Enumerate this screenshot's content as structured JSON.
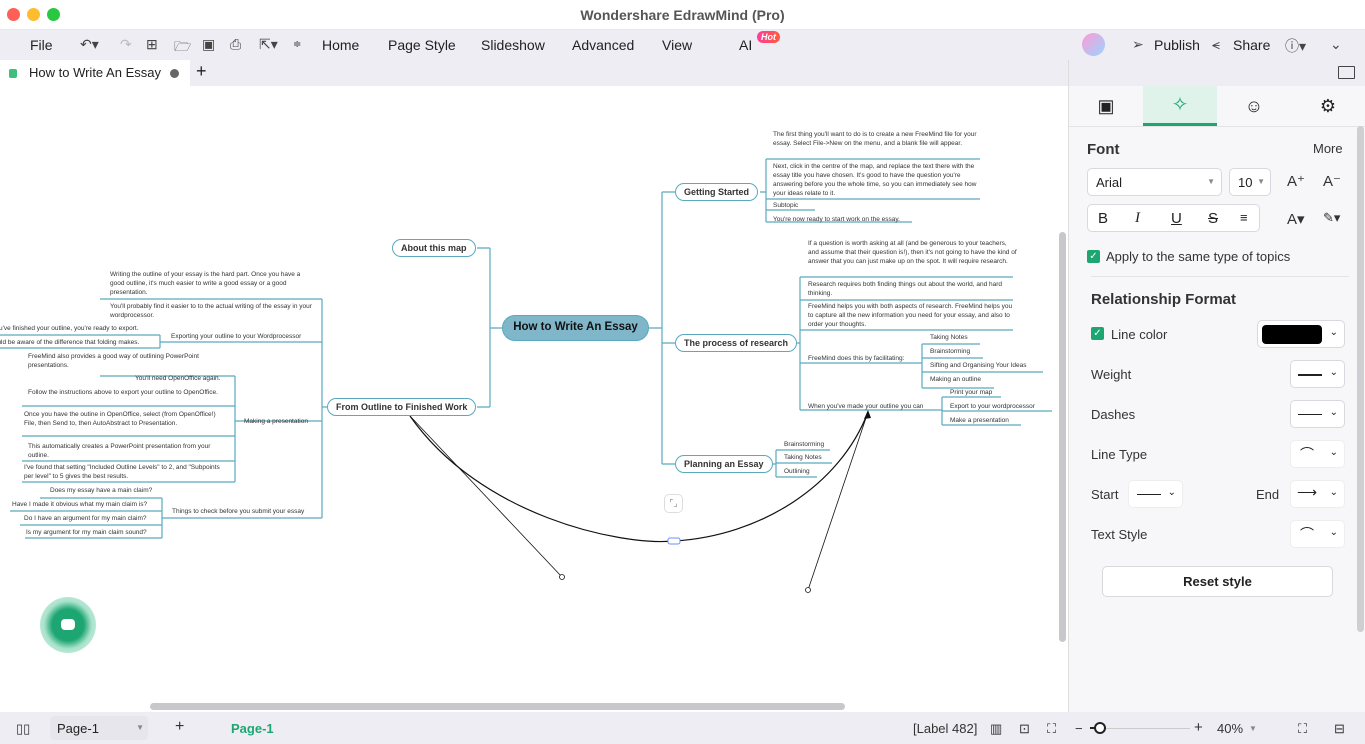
{
  "window": {
    "title": "Wondershare EdrawMind (Pro)"
  },
  "menu": {
    "file": "File",
    "items": [
      "Home",
      "Page Style",
      "Slideshow",
      "Advanced",
      "View",
      "AI"
    ],
    "ai_badge": "Hot",
    "publish": "Publish",
    "share": "Share"
  },
  "tabs": {
    "doc_title": "How to Write An Essay",
    "add_tab": "+"
  },
  "mindmap": {
    "root": "How to Write An Essay",
    "right_topics": {
      "getting_started": {
        "label": "Getting Started",
        "children": [
          "The first thing you'll want to do is to create a new FreeMind file for your essay. Select File->New on the menu, and a blank file will appear.",
          "Next, click in the centre of the map, and replace the text there with the essay title you have chosen. It's good to have the question you're answering before you the whole time, so you can immediately see how your ideas relate to it.",
          "Subtopic",
          "You're now ready to start work on the essay."
        ]
      },
      "research": {
        "label": "The process of research",
        "children": [
          "If a question is worth asking at all (and be generous to your teachers, and assume that their question is!), then it's not going to have the kind of answer that you can just make up on the spot. It will require research.",
          "Research requires both finding things out about the world, and hard thinking.",
          "FreeMind helps you with both aspects of research. FreeMind helps you to capture all the new information you need for your essay, and also to order your thoughts."
        ],
        "facilitating": {
          "label": "FreeMind does this by facilitating:",
          "children": [
            "Taking Notes",
            "Brainstorming",
            "Sifting and Organising Your Ideas",
            "Making an outline"
          ]
        },
        "outline_done": {
          "label": "When you've made your outline you can",
          "children": [
            "Print your map",
            "Export to your wordprocessor",
            "Make a presentation"
          ]
        }
      },
      "planning": {
        "label": "Planning an Essay",
        "children": [
          "Brainstorming",
          "Taking Notes",
          "Outlining"
        ]
      }
    },
    "left_topics": {
      "about": {
        "label": "About this map"
      },
      "finished": {
        "label": "From Outline to Finished Work",
        "intro": [
          "Writing the outline of your essay is the hard part. Once you have a good outline, it's much easier to write a good essay or a good presentation.",
          "You'll probably find it easier to to the actual writing of the essay in your wordprocessor."
        ],
        "exporting": {
          "label": "Exporting your outline to your Wordprocessor",
          "children": [
            "...ou've finished your outline, you're ready to export.",
            "...uld be aware of the difference that folding makes."
          ]
        },
        "presentation": {
          "label": "Making a presentation",
          "pre": "FreeMind also provides a good way of outlining PowerPoint presentations.",
          "children": [
            "You'll need OpenOffice again.",
            "Follow the instructions above to export your outline to OpenOffice.",
            "Once you have the outine in OpenOffice, select (from OpenOffice!) File, then Send to, then AutoAbstract to Presentation.",
            "This automatically creates a PowerPoint presentation from your outline.",
            "I've found that setting \"Included Outline Levels\" to 2, and \"Subpoints per level\" to 5 gives the best results."
          ]
        },
        "checks": {
          "label": "Things to check before you submit your essay",
          "children": [
            "Does my essay have a main claim?",
            "Have I made it obvious what my main claim is?",
            "Do I have an argument for my main claim?",
            "Is my argument for my main claim sound?"
          ]
        }
      }
    },
    "relationship_label": "Label"
  },
  "panel": {
    "font_heading": "Font",
    "more": "More",
    "font_family": "Arial",
    "font_size": "10",
    "apply_same": "Apply to the same type of topics",
    "apply_checked": true,
    "relationship_heading": "Relationship Format",
    "line_color_label": "Line color",
    "line_color": "#000000",
    "line_color_checked": true,
    "weight": "Weight",
    "dashes": "Dashes",
    "line_type": "Line Type",
    "start": "Start",
    "end": "End",
    "text_style": "Text Style",
    "reset": "Reset style"
  },
  "status": {
    "page_select": "Page-1",
    "page_tab": "Page-1",
    "selection": "[Label 482]",
    "zoom": "40%",
    "zoom_fraction": 0.1
  },
  "colors": {
    "accent": "#1ea672",
    "branch": "#5aa9bd",
    "root_fill": "#7fb6c9"
  }
}
